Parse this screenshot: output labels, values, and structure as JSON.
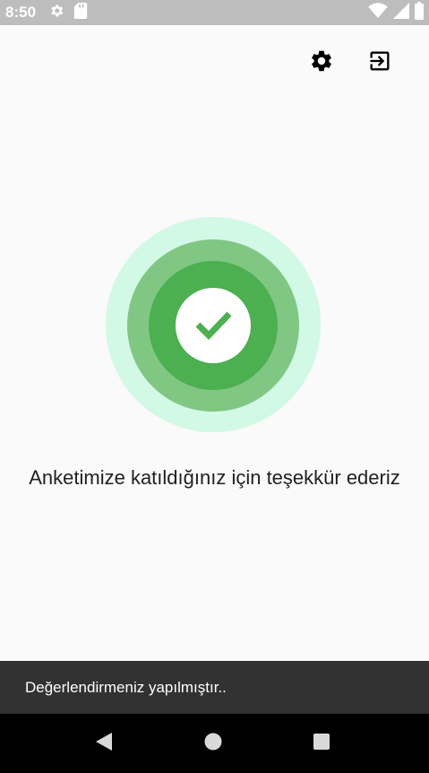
{
  "status_bar": {
    "time": "8:50",
    "left_icons": [
      "settings-gear-icon",
      "sd-card-icon"
    ],
    "right_icons": [
      "wifi-icon",
      "cell-signal-icon",
      "battery-icon"
    ],
    "background": "#bdbdbd"
  },
  "toolbar": {
    "icons": [
      "settings-icon",
      "logout-icon"
    ]
  },
  "success": {
    "colors": {
      "outer_ring": "#d2f8e6",
      "middle_ring": "#81c784",
      "inner_ring": "#4caf50",
      "check": "#4caf50"
    },
    "icon": "check-mark-icon"
  },
  "message": {
    "text": "Anketimize katıldığınız için teşekkür ederiz"
  },
  "snackbar": {
    "text": "Değerlendirmeniz yapılmıştır..",
    "background": "#323232"
  },
  "nav_bar": {
    "buttons": [
      "back-icon",
      "home-icon",
      "recents-icon"
    ]
  }
}
